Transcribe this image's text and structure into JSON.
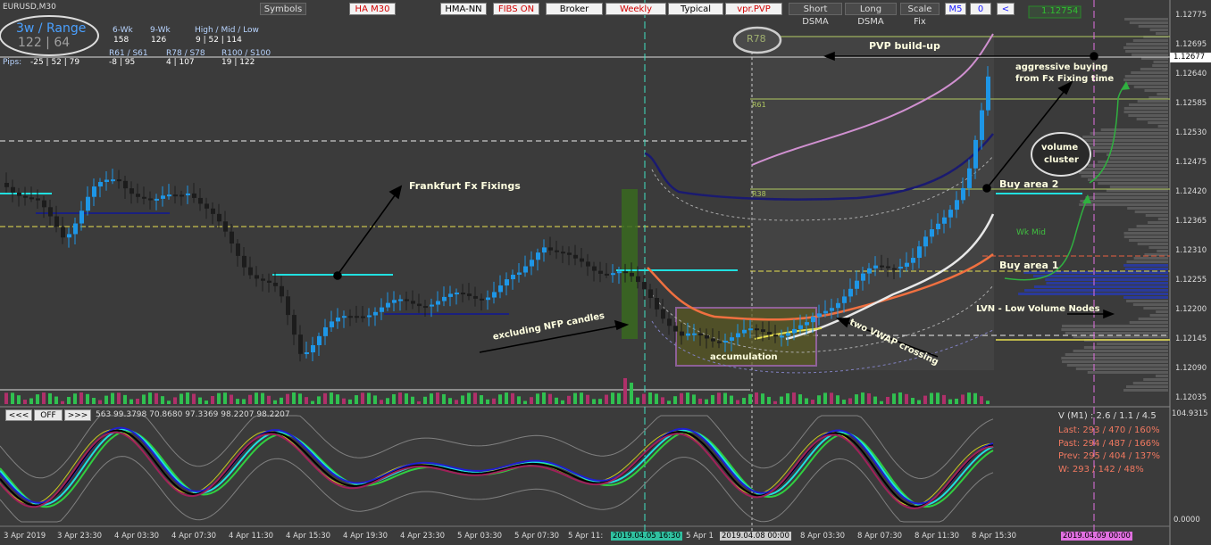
{
  "symbol_title": "EURUSD,M30",
  "toolbar": [
    {
      "label": "Symbols",
      "style": "gray"
    },
    {
      "label": "HA M30",
      "style": "red"
    },
    {
      "label": "HMA-NN",
      "style": "normal"
    },
    {
      "label": "FIBS ON",
      "style": "red"
    },
    {
      "label": "Broker",
      "style": "normal"
    },
    {
      "label": "Weekly",
      "style": "red"
    },
    {
      "label": "Typical",
      "style": "normal"
    },
    {
      "label": "vpr.PVP",
      "style": "red"
    },
    {
      "label": "Short DSMA",
      "style": "gray"
    },
    {
      "label": "Long DSMA",
      "style": "gray"
    },
    {
      "label": "Scale Fix",
      "style": "gray"
    },
    {
      "label": "M5",
      "style": "blue"
    },
    {
      "label": "0",
      "style": "blue"
    },
    {
      "label": "<",
      "style": "blue"
    }
  ],
  "price_tag_top": "1.12754",
  "range_box": {
    "title": "3w / Range",
    "values": "122 | 64"
  },
  "stats_header": {
    "col_6wk": "6-Wk",
    "col_9wk": "9-Wk",
    "col_hml": "High / Mid / Low",
    "v_6wk": "158",
    "v_9wk": "126",
    "v_hml": "9 | 52 | 114",
    "r61": "R61 / S61",
    "r78": "R78 / S78",
    "r100": "R100 / S100",
    "pips_label": "Pips:",
    "pips_a": "-25 | 52 | 79",
    "pips_b": "-8 | 95",
    "pips_c": "4 | 107",
    "pips_d": "19 | 122"
  },
  "price_axis": [
    "1.12775",
    "1.12695",
    "1.12640",
    "1.12585",
    "1.12530",
    "1.12475",
    "1.12420",
    "1.12365",
    "1.12310",
    "1.12255",
    "1.12200",
    "1.12145",
    "1.12090",
    "1.12035"
  ],
  "current_price": "1.12677",
  "osc_axis_top": "104.9315",
  "osc_axis_bottom": "0.0000",
  "time_axis": [
    "3 Apr 2019",
    "3 Apr 23:30",
    "4 Apr 03:30",
    "4 Apr 07:30",
    "4 Apr 11:30",
    "4 Apr 15:30",
    "4 Apr 19:30",
    "4 Apr 23:30",
    "5 Apr 03:30",
    "5 Apr 07:30",
    "5 Apr 11:",
    "2019.04.05 16:30",
    "5 Apr 1",
    "2019.04.08 00:00",
    "8 Apr 03:30",
    "8 Apr 07:30",
    "8 Apr 11:30",
    "8 Apr 15:30",
    "2019.04.09 00:00"
  ],
  "annotations": {
    "r78_badge": "R78",
    "pvp_buildup": "PVP build-up",
    "aggressive_1": "aggressive buying",
    "aggressive_2": "from Fx Fixing time",
    "volume_cluster_1": "volume",
    "volume_cluster_2": "cluster",
    "frankfurt": "Frankfurt Fx Fixings",
    "buy_area_2": "Buy area 2",
    "buy_area_1": "Buy area 1",
    "wk_mid": "Wk Mid",
    "lvn": "LVN - Low Volume Nodes",
    "excluding_nfp": "excluding NFP candles",
    "two_vwap": "two VWAP crossing",
    "accumulation": "accumulation",
    "r61_label": "R61",
    "r38_label": "R38"
  },
  "osc_nav": {
    "prev": "<<<",
    "off": "OFF",
    "next": ">>>"
  },
  "osc_values": "563 99.3798 70.8680 97.3369 98.2207 98.2207",
  "side_stats": {
    "v_line": "V (M1) : 2.6 / 1.1 / 4.5",
    "last": "Last: 293 / 470 / 160%",
    "past": "Past: 294 / 487 / 166%",
    "prev": "Prev: 295 / 404 / 137%",
    "w": "W: 293 / 142 / 48%"
  },
  "colors": {
    "bg": "#3b3b3b",
    "bull": "#1e96e6",
    "bear": "#1c1c1c",
    "annotation": "#ffffe0"
  }
}
